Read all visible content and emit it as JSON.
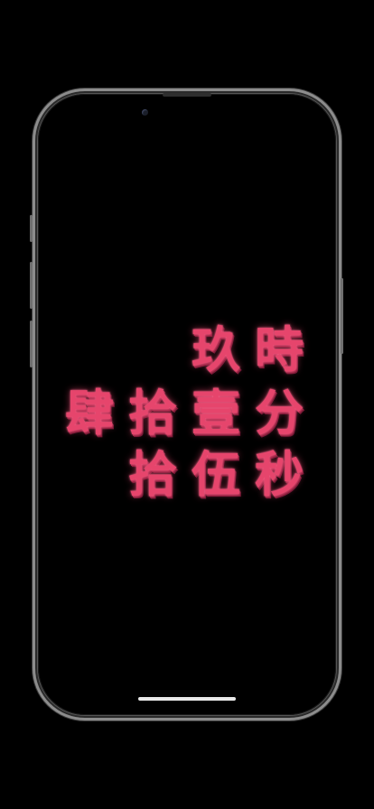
{
  "clock": {
    "hour": [
      "玖",
      "時"
    ],
    "minute": [
      "肆",
      "拾",
      "壹",
      "分"
    ],
    "second": [
      "拾",
      "伍",
      "秒"
    ]
  },
  "colors": {
    "background": "#000000",
    "glyph": "#e6456c",
    "frame": "#8c8c8c",
    "home_indicator": "#e8e8e8"
  },
  "icons": {
    "camera": "front-camera-icon",
    "speaker": "earpiece-speaker-icon"
  }
}
